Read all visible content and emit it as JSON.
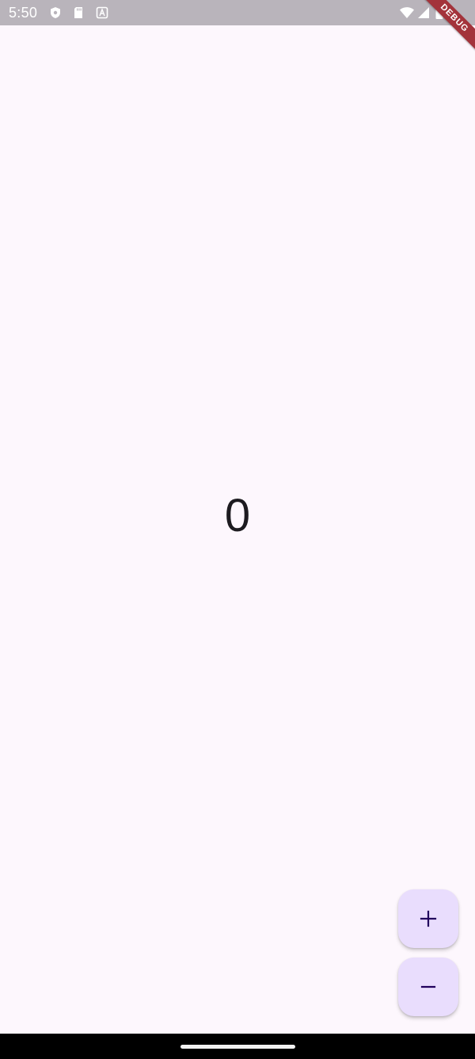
{
  "status_bar": {
    "time": "5:50",
    "left_icons": [
      "shield-icon",
      "sd-card-icon",
      "font-icon"
    ],
    "right_icons": [
      "wifi-icon",
      "cell-signal-icon",
      "battery-icon"
    ]
  },
  "debug_banner": {
    "label": "DEBUG"
  },
  "counter": {
    "value": "0"
  },
  "fabs": {
    "increment_label": "+",
    "decrement_label": "−"
  },
  "colors": {
    "background": "#fdf7fd",
    "fab_background": "#e9ddfd",
    "fab_icon": "#21005d",
    "debug_ribbon": "#a3333b",
    "status_bar": "#b9b4bb"
  }
}
